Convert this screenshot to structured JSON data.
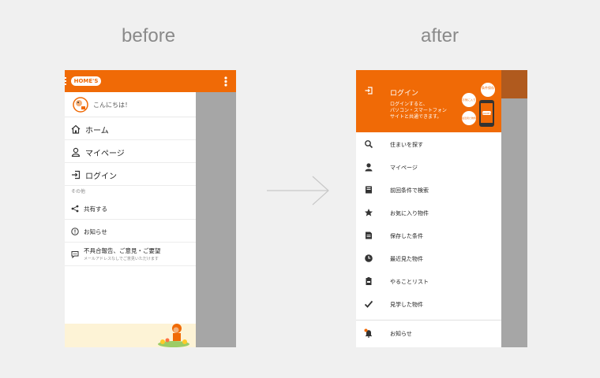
{
  "labels": {
    "before": "before",
    "after": "after"
  },
  "before": {
    "logo": "HOME'S",
    "greeting": "こんにちは！",
    "items": [
      {
        "label": "ホーム",
        "icon": "home-icon"
      },
      {
        "label": "マイページ",
        "icon": "person-icon"
      },
      {
        "label": "ログイン",
        "icon": "login-icon"
      }
    ],
    "section": "その他",
    "others": [
      {
        "label": "共有する",
        "icon": "share-icon"
      },
      {
        "label": "お知らせ",
        "icon": "info-icon"
      }
    ],
    "feedback": {
      "label": "不具合報告、ご意見・ご要望",
      "sub": "メールアドレスなしでご意見いただけます"
    }
  },
  "after": {
    "login": {
      "title": "ログイン",
      "desc1": "ログインすると、",
      "desc2": "パソコン・スマートフォン",
      "desc3": "サイトと共通できます。"
    },
    "art": {
      "b1": "条件保存",
      "b2": "お気に入り",
      "b3": "最近見た物件",
      "device": "HOME'S"
    },
    "items": [
      {
        "label": "住まいを探す",
        "icon": "search-icon"
      },
      {
        "label": "マイページ",
        "icon": "person-icon"
      },
      {
        "label": "前回条件で検索",
        "icon": "book-icon"
      },
      {
        "label": "お気に入り物件",
        "icon": "star-icon"
      },
      {
        "label": "保存した条件",
        "icon": "document-icon"
      },
      {
        "label": "最近見た物件",
        "icon": "clock-icon"
      },
      {
        "label": "やることリスト",
        "icon": "clipboard-icon"
      },
      {
        "label": "見学した物件",
        "icon": "check-icon"
      }
    ],
    "notice": {
      "label": "お知らせ",
      "icon": "bell-icon"
    }
  },
  "colors": {
    "accent": "#f06a06",
    "overlay": "#a6a6a6"
  }
}
